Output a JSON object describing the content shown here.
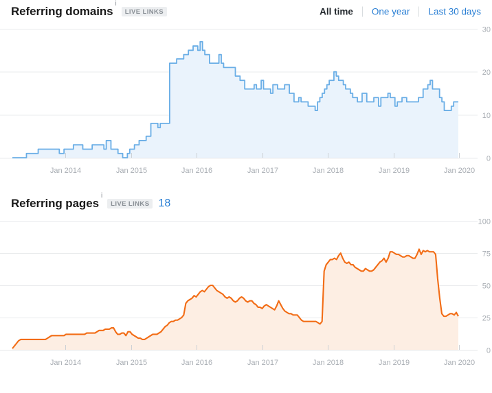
{
  "charts": [
    {
      "id": "referring-domains",
      "title": "Referring domains",
      "info_icon": "i",
      "badge": "LIVE LINKS",
      "count": "",
      "range_switch": {
        "items": [
          {
            "label": "All time",
            "active": true
          },
          {
            "label": "One year",
            "active": false
          },
          {
            "label": "Last 30 days",
            "active": false
          }
        ]
      },
      "colors": {
        "line": "#6aaee6",
        "fill": "#eaf3fc",
        "grid": "#e9ebed",
        "axis_text": "#a8adb3"
      }
    },
    {
      "id": "referring-pages",
      "title": "Referring pages",
      "info_icon": "i",
      "badge": "LIVE LINKS",
      "count": "18",
      "range_switch": null,
      "colors": {
        "line": "#f26c15",
        "fill": "#fdeee3",
        "grid": "#e9ebed",
        "axis_text": "#a8adb3"
      }
    }
  ],
  "chart_data": [
    {
      "type": "area",
      "id": "referring-domains",
      "title": "Referring domains",
      "xlabel": "",
      "ylabel": "",
      "step": true,
      "grid": true,
      "legend": null,
      "ylim": [
        0,
        30
      ],
      "yticks": [
        0,
        10,
        20,
        30
      ],
      "ytick_labels": [
        "0",
        "10",
        "20",
        "30"
      ],
      "xticks": [
        "Jan 2014",
        "Jan 2015",
        "Jan 2016",
        "Jan 2017",
        "Jan 2018",
        "Jan 2019",
        "Jan 2020"
      ],
      "xlim": [
        "2013-07",
        "2020-09"
      ],
      "series": [
        {
          "name": "Referring domains",
          "color": "#6aaee6",
          "values": [
            0,
            0,
            0,
            0,
            0,
            0,
            1,
            1,
            1,
            1,
            1,
            2,
            2,
            2,
            2,
            2,
            2,
            2,
            2,
            2,
            1,
            1,
            2,
            2,
            2,
            2,
            3,
            3,
            3,
            3,
            2,
            2,
            2,
            2,
            3,
            3,
            3,
            3,
            3,
            2,
            4,
            4,
            2,
            2,
            2,
            1,
            1,
            0,
            0,
            1,
            2,
            2,
            3,
            3,
            4,
            4,
            4,
            5,
            5,
            8,
            8,
            8,
            7,
            8,
            8,
            8,
            8,
            22,
            22,
            22,
            23,
            23,
            23,
            24,
            24,
            25,
            25,
            26,
            26,
            25,
            27,
            25,
            24,
            24,
            22,
            22,
            22,
            22,
            24,
            22,
            21,
            21,
            21,
            21,
            21,
            19,
            19,
            18,
            18,
            16,
            16,
            16,
            16,
            17,
            16,
            16,
            18,
            16,
            16,
            16,
            15,
            17,
            17,
            16,
            16,
            16,
            17,
            17,
            15,
            15,
            13,
            13,
            14,
            13,
            13,
            13,
            12,
            12,
            12,
            11,
            13,
            14,
            15,
            16,
            17,
            18,
            18,
            20,
            19,
            18,
            18,
            17,
            16,
            16,
            15,
            14,
            14,
            13,
            13,
            15,
            15,
            13,
            13,
            13,
            14,
            14,
            12,
            14,
            14,
            14,
            15,
            14,
            14,
            12,
            13,
            13,
            14,
            14,
            13,
            13,
            13,
            13,
            13,
            14,
            14,
            16,
            16,
            17,
            18,
            16,
            16,
            16,
            14,
            13,
            11,
            11,
            11,
            12,
            13,
            13,
            13
          ]
        }
      ]
    },
    {
      "type": "area",
      "id": "referring-pages",
      "title": "Referring pages",
      "xlabel": "",
      "ylabel": "",
      "step": false,
      "grid": true,
      "legend": null,
      "ylim": [
        0,
        100
      ],
      "yticks": [
        0,
        25,
        50,
        75,
        100
      ],
      "ytick_labels": [
        "0",
        "25",
        "50",
        "75",
        "100"
      ],
      "xticks": [
        "Jan 2014",
        "Jan 2015",
        "Jan 2016",
        "Jan 2017",
        "Jan 2018",
        "Jan 2019",
        "Jan 2020"
      ],
      "xlim": [
        "2013-07",
        "2020-09"
      ],
      "series": [
        {
          "name": "Referring pages",
          "color": "#f26c15",
          "values": [
            1,
            3,
            5,
            7,
            8,
            8,
            8,
            8,
            8,
            8,
            8,
            8,
            8,
            8,
            8,
            8,
            8,
            9,
            10,
            11,
            11,
            11,
            11,
            11,
            11,
            11,
            12,
            12,
            12,
            12,
            12,
            12,
            12,
            12,
            12,
            12,
            13,
            13,
            13,
            13,
            13,
            14,
            15,
            15,
            15,
            16,
            16,
            16,
            17,
            17,
            14,
            12,
            12,
            13,
            13,
            11,
            14,
            14,
            12,
            11,
            10,
            9,
            9,
            8,
            8,
            9,
            10,
            11,
            12,
            12,
            12,
            13,
            14,
            16,
            18,
            19,
            21,
            22,
            22,
            23,
            23,
            24,
            25,
            27,
            36,
            38,
            39,
            40,
            42,
            41,
            43,
            45,
            46,
            45,
            47,
            49,
            50,
            50,
            48,
            46,
            45,
            44,
            43,
            41,
            40,
            41,
            40,
            38,
            37,
            38,
            40,
            41,
            40,
            38,
            37,
            38,
            38,
            36,
            35,
            33,
            33,
            32,
            34,
            35,
            34,
            33,
            32,
            31,
            34,
            38,
            35,
            32,
            30,
            29,
            28,
            28,
            27,
            27,
            27,
            25,
            23,
            22,
            22,
            22,
            22,
            22,
            22,
            22,
            21,
            20,
            22,
            61,
            66,
            68,
            70,
            70,
            71,
            70,
            73,
            75,
            71,
            68,
            67,
            68,
            66,
            66,
            64,
            63,
            62,
            61,
            61,
            63,
            62,
            61,
            61,
            62,
            64,
            66,
            68,
            69,
            71,
            68,
            71,
            76,
            76,
            75,
            74,
            74,
            73,
            72,
            72,
            73,
            73,
            72,
            71,
            71,
            74,
            78,
            74,
            77,
            76,
            77,
            76,
            76,
            76,
            74,
            55,
            40,
            28,
            26,
            26,
            27,
            28,
            28,
            27,
            29,
            26
          ]
        }
      ]
    }
  ]
}
